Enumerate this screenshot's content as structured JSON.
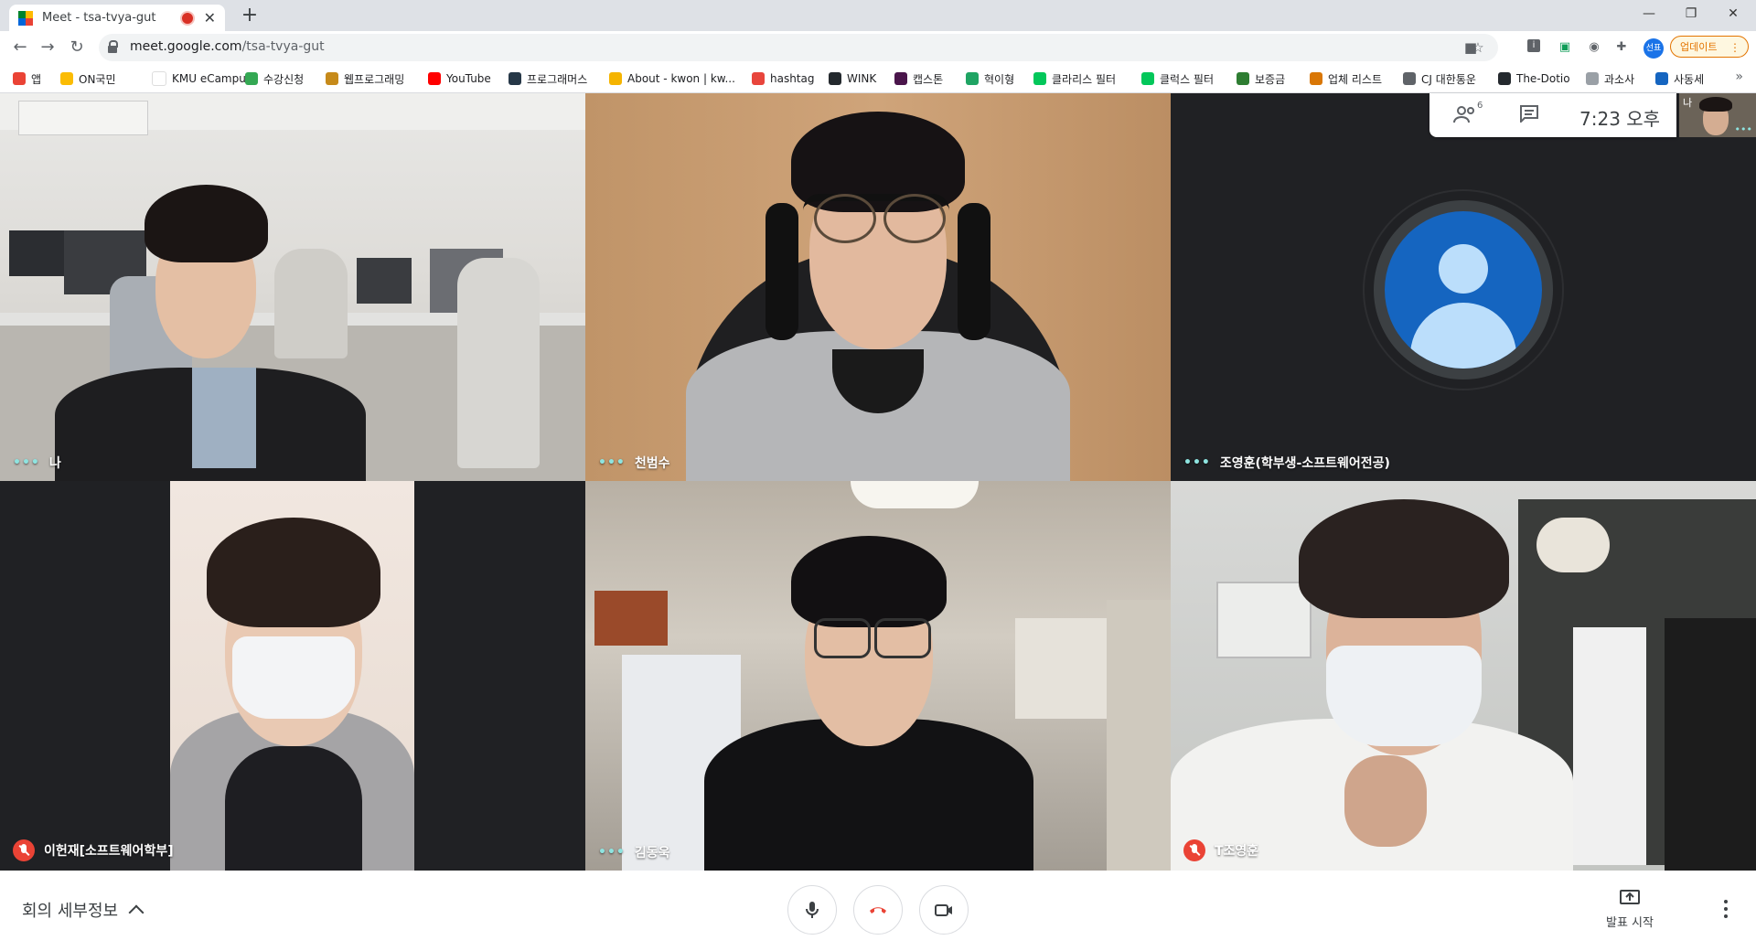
{
  "browser": {
    "tab_title": "Meet - tsa-tvya-gut",
    "tab_close": "✕",
    "new_tab": "+",
    "url_host": "meet.google.com",
    "url_path": "/tsa-tvya-gut",
    "profile_initials": "선표",
    "update_label": "업데이트",
    "win_min": "—",
    "win_restore": "❐",
    "win_close": "✕"
  },
  "bookmarks": [
    {
      "label": "앱",
      "color": "#ea4335"
    },
    {
      "label": "ON국민",
      "color": "#fbbc04"
    },
    {
      "label": "KMU eCampus",
      "color": "#ffffff"
    },
    {
      "label": "수강신청",
      "color": "#34a853"
    },
    {
      "label": "웹프로그래밍",
      "color": "#c68a1a"
    },
    {
      "label": "YouTube",
      "color": "#ff0000"
    },
    {
      "label": "프로그래머스",
      "color": "#263747"
    },
    {
      "label": "About - kwon | kw...",
      "color": "#f5b400"
    },
    {
      "label": "hashtag",
      "color": "#e8453c"
    },
    {
      "label": "WINK",
      "color": "#24292e"
    },
    {
      "label": "캡스톤",
      "color": "#4a154b"
    },
    {
      "label": "혁이형",
      "color": "#1fa463"
    },
    {
      "label": "클라리스 필터",
      "color": "#03c75a"
    },
    {
      "label": "클럭스 필터",
      "color": "#03c75a"
    },
    {
      "label": "보증금",
      "color": "#2e7d32"
    },
    {
      "label": "업체 리스트",
      "color": "#d97706"
    },
    {
      "label": "CJ 대한통운",
      "color": "#5f6368"
    },
    {
      "label": "The-Dotio",
      "color": "#24292e"
    },
    {
      "label": "과소사",
      "color": "#9aa0a6"
    },
    {
      "label": "사동세",
      "color": "#1565c0"
    }
  ],
  "participants": [
    {
      "name": "나",
      "muted": false,
      "scene": "office"
    },
    {
      "name": "천범수",
      "muted": false,
      "scene": "wall"
    },
    {
      "name": "조영훈(학부생-소프트웨어전공)",
      "muted": false,
      "scene": "avatar"
    },
    {
      "name": "이헌재[소프트웨어학부]",
      "muted": true,
      "scene": "portrait"
    },
    {
      "name": "김동욱",
      "muted": false,
      "scene": "room"
    },
    {
      "name": "T조영훈",
      "muted": true,
      "scene": "closet"
    }
  ],
  "info_panel": {
    "people_count": "6",
    "time": "7:23 오후"
  },
  "self_view": {
    "label": "나",
    "dots": "•••"
  },
  "tile_dots": "•••",
  "bottom_bar": {
    "meeting_details": "회의 세부정보",
    "present_label": "발표 시작"
  },
  "colors": {
    "stage_bg": "#202124",
    "hangup": "#ea4335",
    "mute_red": "#ea4335",
    "voice_dots": "#8ee4e0"
  }
}
